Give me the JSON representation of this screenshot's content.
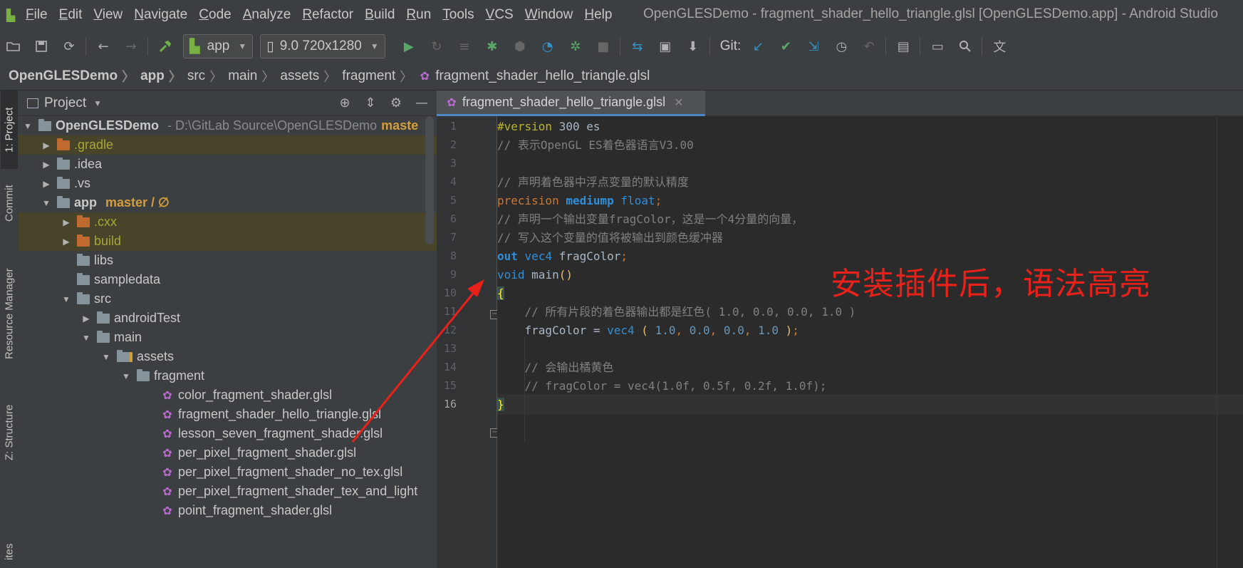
{
  "window": {
    "title": "OpenGLESDemo - fragment_shader_hello_triangle.glsl [OpenGLESDemo.app] - Android Studio"
  },
  "menu": [
    "File",
    "Edit",
    "View",
    "Navigate",
    "Code",
    "Analyze",
    "Refactor",
    "Build",
    "Run",
    "Tools",
    "VCS",
    "Window",
    "Help"
  ],
  "toolbar": {
    "module": "app",
    "device": "9.0 720x1280",
    "git_label": "Git:"
  },
  "breadcrumbs": [
    "OpenGLESDemo",
    "app",
    "src",
    "main",
    "assets",
    "fragment",
    "fragment_shader_hello_triangle.glsl"
  ],
  "side_tabs": [
    "1: Project",
    "Commit",
    "Resource Manager",
    "Z: Structure",
    "ites"
  ],
  "project_panel": {
    "title": "Project",
    "tree": [
      {
        "label": "OpenGLESDemo",
        "suffix": "- D:\\GitLab Source\\OpenGLESDemo",
        "branch": "maste"
      },
      {
        "label": ".gradle"
      },
      {
        "label": ".idea"
      },
      {
        "label": ".vs"
      },
      {
        "label": "app",
        "branch": "master / ∅"
      },
      {
        "label": ".cxx"
      },
      {
        "label": "build"
      },
      {
        "label": "libs"
      },
      {
        "label": "sampledata"
      },
      {
        "label": "src"
      },
      {
        "label": "androidTest"
      },
      {
        "label": "main"
      },
      {
        "label": "assets"
      },
      {
        "label": "fragment"
      },
      {
        "label": "color_fragment_shader.glsl"
      },
      {
        "label": "fragment_shader_hello_triangle.glsl"
      },
      {
        "label": "lesson_seven_fragment_shader.glsl"
      },
      {
        "label": "per_pixel_fragment_shader.glsl"
      },
      {
        "label": "per_pixel_fragment_shader_no_tex.glsl"
      },
      {
        "label": "per_pixel_fragment_shader_tex_and_light"
      },
      {
        "label": "point_fragment_shader.glsl"
      }
    ]
  },
  "editor": {
    "tab_label": "fragment_shader_hello_triangle.glsl",
    "line_numbers": [
      "1",
      "2",
      "3",
      "4",
      "5",
      "6",
      "7",
      "8",
      "9",
      "10",
      "11",
      "12",
      "13",
      "14",
      "15",
      "16"
    ],
    "code": {
      "l1_directive": "#version",
      "l1_rest": " 300 es",
      "l2": "// 表示OpenGL ES着色器语言V3.00",
      "l4": "// 声明着色器中浮点变量的默认精度",
      "l5_precision": "precision",
      "l5_mediump": "mediump",
      "l5_float": "float",
      "l5_semi": ";",
      "l6": "// 声明一个输出变量fragColor，这是一个4分量的向量，",
      "l7": "// 写入这个变量的值将被输出到颜色缓冲器",
      "l8_out": "out",
      "l8_vec4": "vec4",
      "l8_name": "fragColor",
      "l8_semi": ";",
      "l9_void": "void",
      "l9_main": "main",
      "l9_parens": "()",
      "l10_brace": "{",
      "l11": "// 所有片段的着色器输出都是红色( 1.0, 0.0, 0.0, 1.0 )",
      "l12_name": "fragColor",
      "l12_eq": " = ",
      "l12_vec4": "vec4",
      "l12_open": " ( ",
      "l12_n1": "1.0",
      "l12_c1": ", ",
      "l12_n2": "0.0",
      "l12_c2": ", ",
      "l12_n3": "0.0",
      "l12_c3": ", ",
      "l12_n4": "1.0",
      "l12_close": " )",
      "l12_semi": ";",
      "l14": "// 会输出橘黄色",
      "l15": "// fragColor = vec4(1.0f, 0.5f, 0.2f, 1.0f);",
      "l16_brace": "}"
    }
  },
  "annotation": {
    "text": "安装插件后，语法高亮",
    "color": "#e8211a"
  }
}
